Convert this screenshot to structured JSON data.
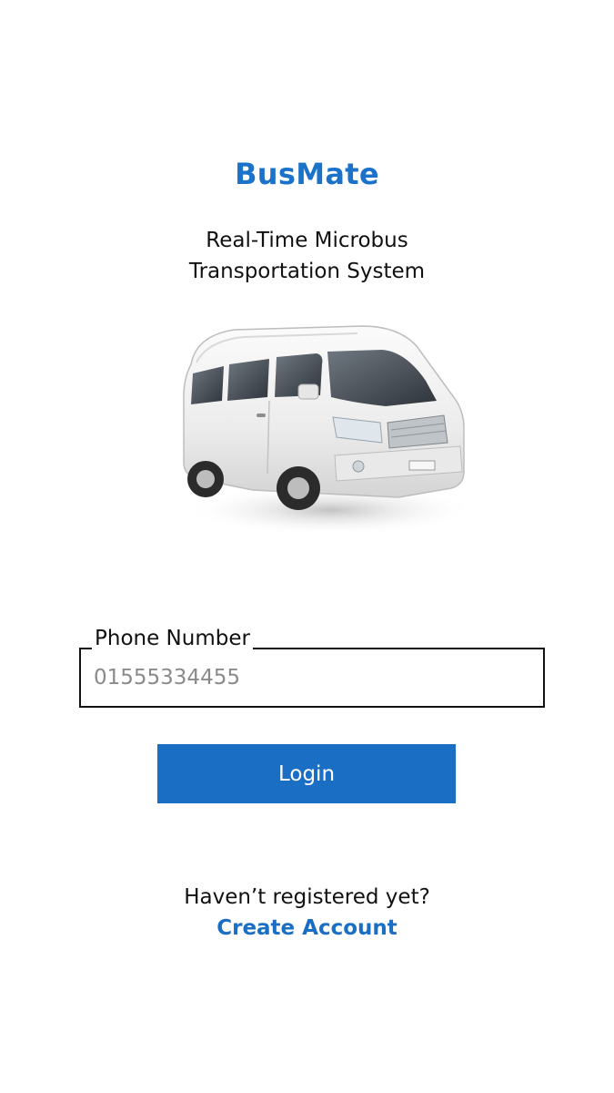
{
  "app": {
    "title": "BusMate",
    "subtitle_line1": "Real-Time Microbus",
    "subtitle_line2": "Transportation System"
  },
  "hero_image": {
    "icon": "microbus-image"
  },
  "login_form": {
    "phone_label": "Phone Number",
    "phone_value": "",
    "phone_placeholder": "01555334455",
    "login_label": "Login"
  },
  "footer": {
    "register_prompt": "Haven’t registered yet?",
    "create_account_label": "Create Account"
  },
  "colors": {
    "accent": "#1a73c8",
    "button": "#1a6fc4",
    "background": "#ffffff",
    "text": "#111111",
    "placeholder": "#8a8a8a"
  }
}
